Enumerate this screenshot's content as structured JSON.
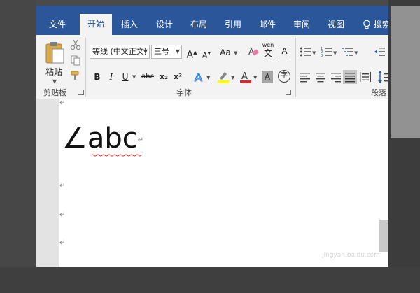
{
  "tabs": [
    {
      "label": "文件",
      "active": false
    },
    {
      "label": "开始",
      "active": true
    },
    {
      "label": "插入",
      "active": false
    },
    {
      "label": "设计",
      "active": false
    },
    {
      "label": "布局",
      "active": false
    },
    {
      "label": "引用",
      "active": false
    },
    {
      "label": "邮件",
      "active": false
    },
    {
      "label": "审阅",
      "active": false
    },
    {
      "label": "视图",
      "active": false
    }
  ],
  "search": {
    "label": "搜索"
  },
  "clipboard": {
    "paste_label": "粘贴",
    "group_label": "剪贴板"
  },
  "font": {
    "font_name": "等线 (中文正文)",
    "font_size": "三号",
    "change_case_label": "Aa",
    "bold": "B",
    "italic": "I",
    "underline": "U",
    "strike": "abc",
    "subscript": "x₂",
    "superscript": "x²",
    "phonetic_top": "wén",
    "phonetic_char": "文",
    "border_char": "A",
    "enclose_char": "字",
    "group_label": "字体"
  },
  "paragraph": {
    "group_label": "段落"
  },
  "document": {
    "text": "∠abc",
    "paragraph_mark": "↵"
  },
  "watermark": "jingyan.baidu.com",
  "colors": {
    "ribbon_blue": "#2b579a",
    "highlight_yellow": "#ffff00",
    "font_red": "#d22d2d",
    "text_effect_blue": "#2b7cd3"
  }
}
